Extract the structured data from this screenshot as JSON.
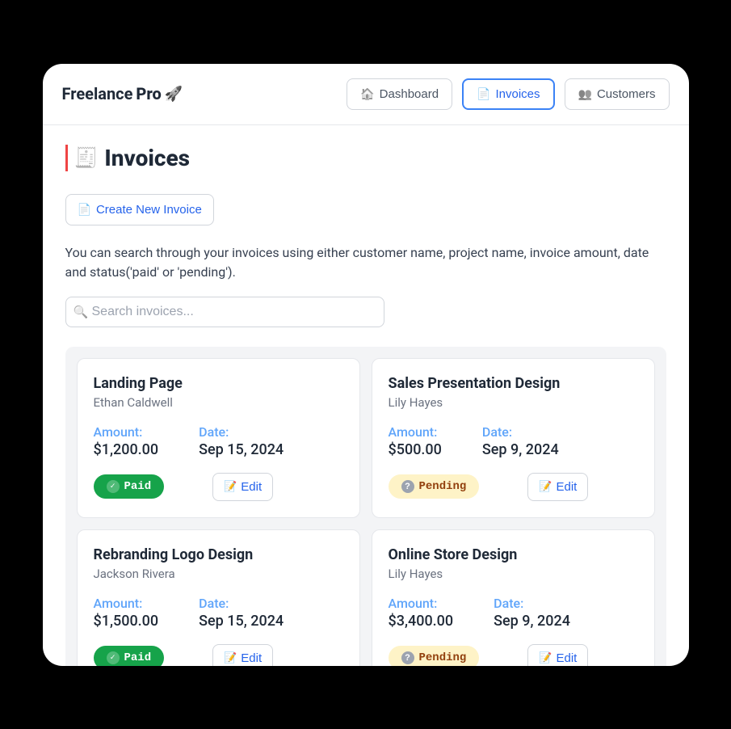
{
  "brand": {
    "name_a": "Freelance",
    "name_b": "Pro",
    "rocket": "🚀"
  },
  "nav": {
    "dashboard": {
      "icon": "🏠",
      "label": "Dashboard"
    },
    "invoices": {
      "icon": "📄",
      "label": "Invoices"
    },
    "customers": {
      "icon": "👥",
      "label": "Customers"
    }
  },
  "page": {
    "icon": "🧾",
    "title": "Invoices",
    "create_icon": "📄",
    "create_label": "Create New Invoice",
    "help_text": "You can search through your invoices using either customer name, project name, invoice amount, date and status('paid' or 'pending').",
    "search_icon": "🔍",
    "search_placeholder": "Search invoices..."
  },
  "labels": {
    "amount": "Amount:",
    "date": "Date:",
    "edit": "Edit",
    "edit_icon": "📝",
    "paid": "Paid",
    "pending": "Pending"
  },
  "invoices": [
    {
      "project": "Landing Page",
      "customer": "Ethan Caldwell",
      "amount": "$1,200.00",
      "date": "Sep 15, 2024",
      "status": "paid"
    },
    {
      "project": "Sales Presentation Design",
      "customer": "Lily Hayes",
      "amount": "$500.00",
      "date": "Sep 9, 2024",
      "status": "pending"
    },
    {
      "project": "Rebranding Logo Design",
      "customer": "Jackson Rivera",
      "amount": "$1,500.00",
      "date": "Sep 15, 2024",
      "status": "paid"
    },
    {
      "project": "Online Store Design",
      "customer": "Lily Hayes",
      "amount": "$3,400.00",
      "date": "Sep 9, 2024",
      "status": "pending"
    }
  ]
}
